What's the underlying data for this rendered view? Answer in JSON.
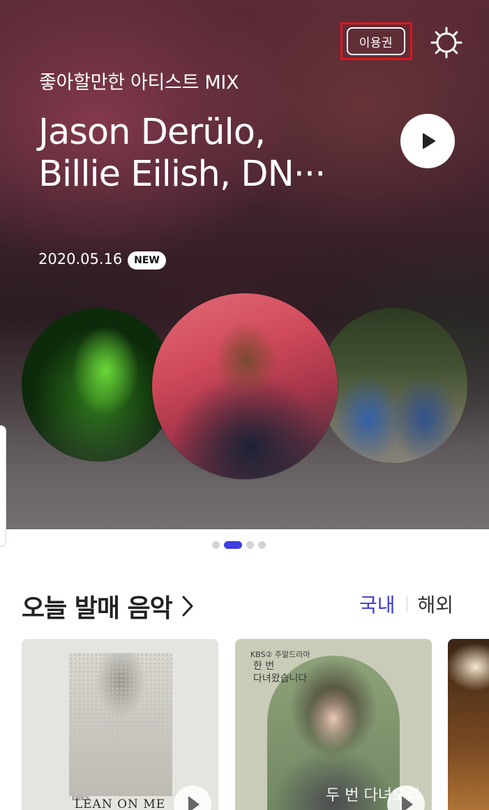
{
  "header": {
    "pass_label": "이용권",
    "settings_icon": "gear-icon"
  },
  "hero": {
    "subtitle": "좋아할만한 아티스트 MIX",
    "title_line1": "Jason Derülo,",
    "title_line2": "Billie Eilish, DN···",
    "date": "2020.05.16",
    "badge": "NEW",
    "play_icon": "play-icon",
    "artists": [
      "Billie Eilish",
      "Jason Derülo",
      "DNCE"
    ]
  },
  "pager": {
    "count": 4,
    "active_index": 1
  },
  "section": {
    "title": "오늘 발매 음악",
    "tabs": [
      {
        "label": "국내",
        "active": true
      },
      {
        "label": "해외",
        "active": false
      }
    ]
  },
  "albums": [
    {
      "cover_text": "LEAN ON ME",
      "cover_small": "ERIK'S"
    },
    {
      "cover_top": "KBS② 주말드라마",
      "cover_title_1": "한 번",
      "cover_title_2": "다녀왔습니다",
      "cover_bottom": "두 번 다녀오리"
    },
    {}
  ],
  "colors": {
    "accent": "#3b3bdc",
    "highlight": "#e0141c"
  }
}
